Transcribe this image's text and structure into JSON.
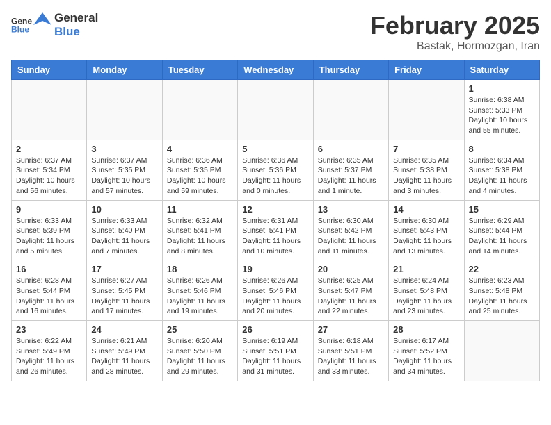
{
  "header": {
    "logo_general": "General",
    "logo_blue": "Blue",
    "month": "February 2025",
    "location": "Bastak, Hormozgan, Iran"
  },
  "weekdays": [
    "Sunday",
    "Monday",
    "Tuesday",
    "Wednesday",
    "Thursday",
    "Friday",
    "Saturday"
  ],
  "weeks": [
    [
      {
        "day": "",
        "info": ""
      },
      {
        "day": "",
        "info": ""
      },
      {
        "day": "",
        "info": ""
      },
      {
        "day": "",
        "info": ""
      },
      {
        "day": "",
        "info": ""
      },
      {
        "day": "",
        "info": ""
      },
      {
        "day": "1",
        "info": "Sunrise: 6:38 AM\nSunset: 5:33 PM\nDaylight: 10 hours\nand 55 minutes."
      }
    ],
    [
      {
        "day": "2",
        "info": "Sunrise: 6:37 AM\nSunset: 5:34 PM\nDaylight: 10 hours\nand 56 minutes."
      },
      {
        "day": "3",
        "info": "Sunrise: 6:37 AM\nSunset: 5:35 PM\nDaylight: 10 hours\nand 57 minutes."
      },
      {
        "day": "4",
        "info": "Sunrise: 6:36 AM\nSunset: 5:35 PM\nDaylight: 10 hours\nand 59 minutes."
      },
      {
        "day": "5",
        "info": "Sunrise: 6:36 AM\nSunset: 5:36 PM\nDaylight: 11 hours\nand 0 minutes."
      },
      {
        "day": "6",
        "info": "Sunrise: 6:35 AM\nSunset: 5:37 PM\nDaylight: 11 hours\nand 1 minute."
      },
      {
        "day": "7",
        "info": "Sunrise: 6:35 AM\nSunset: 5:38 PM\nDaylight: 11 hours\nand 3 minutes."
      },
      {
        "day": "8",
        "info": "Sunrise: 6:34 AM\nSunset: 5:38 PM\nDaylight: 11 hours\nand 4 minutes."
      }
    ],
    [
      {
        "day": "9",
        "info": "Sunrise: 6:33 AM\nSunset: 5:39 PM\nDaylight: 11 hours\nand 5 minutes."
      },
      {
        "day": "10",
        "info": "Sunrise: 6:33 AM\nSunset: 5:40 PM\nDaylight: 11 hours\nand 7 minutes."
      },
      {
        "day": "11",
        "info": "Sunrise: 6:32 AM\nSunset: 5:41 PM\nDaylight: 11 hours\nand 8 minutes."
      },
      {
        "day": "12",
        "info": "Sunrise: 6:31 AM\nSunset: 5:41 PM\nDaylight: 11 hours\nand 10 minutes."
      },
      {
        "day": "13",
        "info": "Sunrise: 6:30 AM\nSunset: 5:42 PM\nDaylight: 11 hours\nand 11 minutes."
      },
      {
        "day": "14",
        "info": "Sunrise: 6:30 AM\nSunset: 5:43 PM\nDaylight: 11 hours\nand 13 minutes."
      },
      {
        "day": "15",
        "info": "Sunrise: 6:29 AM\nSunset: 5:44 PM\nDaylight: 11 hours\nand 14 minutes."
      }
    ],
    [
      {
        "day": "16",
        "info": "Sunrise: 6:28 AM\nSunset: 5:44 PM\nDaylight: 11 hours\nand 16 minutes."
      },
      {
        "day": "17",
        "info": "Sunrise: 6:27 AM\nSunset: 5:45 PM\nDaylight: 11 hours\nand 17 minutes."
      },
      {
        "day": "18",
        "info": "Sunrise: 6:26 AM\nSunset: 5:46 PM\nDaylight: 11 hours\nand 19 minutes."
      },
      {
        "day": "19",
        "info": "Sunrise: 6:26 AM\nSunset: 5:46 PM\nDaylight: 11 hours\nand 20 minutes."
      },
      {
        "day": "20",
        "info": "Sunrise: 6:25 AM\nSunset: 5:47 PM\nDaylight: 11 hours\nand 22 minutes."
      },
      {
        "day": "21",
        "info": "Sunrise: 6:24 AM\nSunset: 5:48 PM\nDaylight: 11 hours\nand 23 minutes."
      },
      {
        "day": "22",
        "info": "Sunrise: 6:23 AM\nSunset: 5:48 PM\nDaylight: 11 hours\nand 25 minutes."
      }
    ],
    [
      {
        "day": "23",
        "info": "Sunrise: 6:22 AM\nSunset: 5:49 PM\nDaylight: 11 hours\nand 26 minutes."
      },
      {
        "day": "24",
        "info": "Sunrise: 6:21 AM\nSunset: 5:49 PM\nDaylight: 11 hours\nand 28 minutes."
      },
      {
        "day": "25",
        "info": "Sunrise: 6:20 AM\nSunset: 5:50 PM\nDaylight: 11 hours\nand 29 minutes."
      },
      {
        "day": "26",
        "info": "Sunrise: 6:19 AM\nSunset: 5:51 PM\nDaylight: 11 hours\nand 31 minutes."
      },
      {
        "day": "27",
        "info": "Sunrise: 6:18 AM\nSunset: 5:51 PM\nDaylight: 11 hours\nand 33 minutes."
      },
      {
        "day": "28",
        "info": "Sunrise: 6:17 AM\nSunset: 5:52 PM\nDaylight: 11 hours\nand 34 minutes."
      },
      {
        "day": "",
        "info": ""
      }
    ]
  ]
}
